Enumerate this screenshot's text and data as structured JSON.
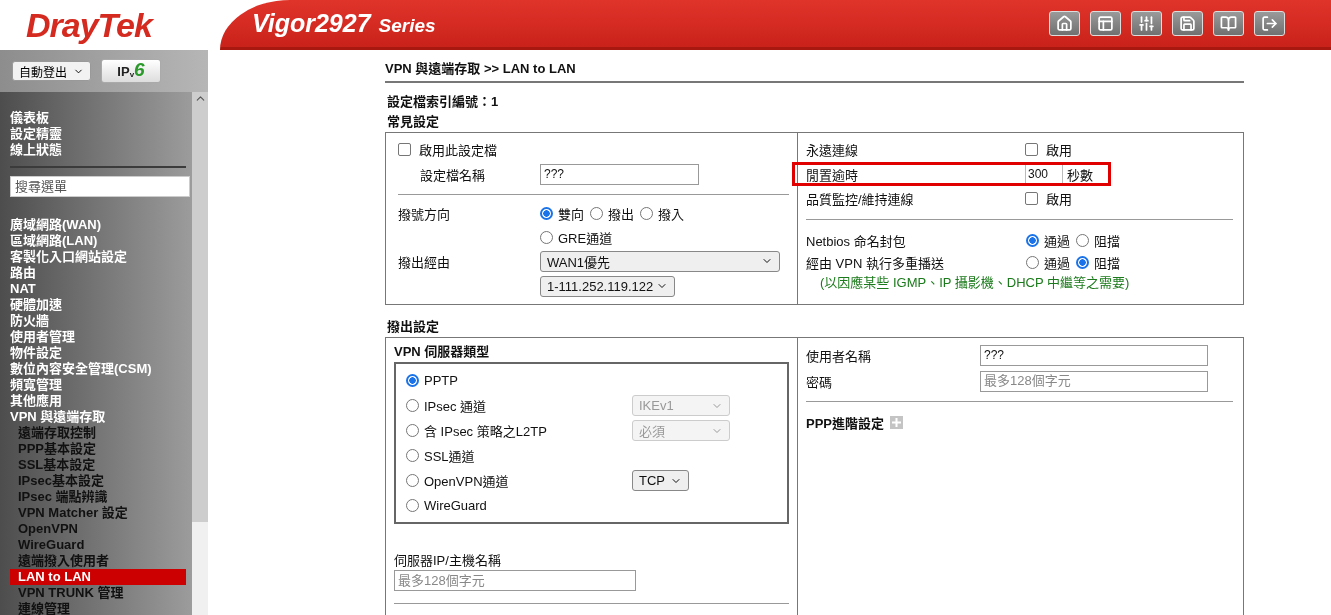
{
  "header": {
    "brand": "DrayTek",
    "model": "Vigor2927",
    "series": "Series"
  },
  "sidebar": {
    "logout_select": {
      "value": "自動登出"
    },
    "ipv6_button": {
      "ip": "IP",
      "v": "v",
      "six": "6"
    },
    "quick_links": [
      {
        "label": "儀表板",
        "selected": false
      },
      {
        "label": "設定精靈",
        "selected": false
      },
      {
        "label": "線上狀態",
        "selected": false
      }
    ],
    "search": {
      "placeholder": "搜尋選單"
    },
    "menu": [
      {
        "label": "廣域網路(WAN)",
        "selected": false
      },
      {
        "label": "區域網路(LAN)",
        "selected": false
      },
      {
        "label": "客製化入口網站設定",
        "selected": false
      },
      {
        "label": "路由",
        "selected": false
      },
      {
        "label": "NAT",
        "selected": false
      },
      {
        "label": "硬體加速",
        "selected": false
      },
      {
        "label": "防火牆",
        "selected": false
      },
      {
        "label": "使用者管理",
        "selected": false
      },
      {
        "label": "物件設定",
        "selected": false
      },
      {
        "label": "數位內容安全管理(CSM)",
        "selected": false
      },
      {
        "label": "頻寬管理",
        "selected": false
      },
      {
        "label": "其他應用",
        "selected": false
      },
      {
        "label": "VPN 與遠端存取",
        "selected": false,
        "children": [
          {
            "label": "遠端存取控制",
            "selected": false
          },
          {
            "label": "PPP基本設定",
            "selected": false
          },
          {
            "label": "SSL基本設定",
            "selected": false
          },
          {
            "label": "IPsec基本設定",
            "selected": false
          },
          {
            "label": "IPsec 端點辨識",
            "selected": false
          },
          {
            "label": "VPN Matcher 設定",
            "selected": false
          },
          {
            "label": "OpenVPN",
            "selected": false
          },
          {
            "label": "WireGuard",
            "selected": false
          },
          {
            "label": "遠端撥入使用者",
            "selected": false
          },
          {
            "label": "LAN to LAN",
            "selected": true
          },
          {
            "label": "VPN TRUNK 管理",
            "selected": false
          },
          {
            "label": "連線管理",
            "selected": false
          }
        ]
      }
    ]
  },
  "page": {
    "breadcrumb": "VPN 與遠端存取 >> LAN to LAN",
    "profile_index": "設定檔索引編號：1",
    "common": {
      "title": "常見設定",
      "enable_profile": {
        "label": "啟用此設定檔",
        "checked": false
      },
      "profile_name": {
        "label": "設定檔名稱",
        "value": "???"
      },
      "dial_direction": {
        "label": "撥號方向",
        "options": [
          {
            "label": "雙向",
            "selected": true
          },
          {
            "label": "撥出",
            "selected": false
          },
          {
            "label": "撥入",
            "selected": false
          },
          {
            "label": "GRE通道",
            "selected": false
          }
        ]
      },
      "dial_out_via": {
        "label": "撥出經由",
        "wan_select": "WAN1優先",
        "ip_select": "1-111.252.119.122"
      },
      "right_rows": [
        {
          "kind": "checkbox",
          "label": "永遠連線",
          "option": "啟用",
          "checked": false
        },
        {
          "kind": "input",
          "label": "閒置逾時",
          "value": "300",
          "unit": "秒數",
          "highlighted": true
        },
        {
          "kind": "checkbox",
          "label": "品質監控/維持連線",
          "option": "啟用",
          "checked": false
        }
      ],
      "packet_rows": [
        {
          "label": "Netbios 命名封包",
          "options": [
            {
              "label": "通過",
              "selected": true
            },
            {
              "label": "阻擋",
              "selected": false
            }
          ]
        },
        {
          "label": "經由 VPN 執行多重播送",
          "options": [
            {
              "label": "通過",
              "selected": false
            },
            {
              "label": "阻擋",
              "selected": true
            }
          ]
        }
      ],
      "note": "(以因應某些 IGMP、IP 攝影機、DHCP 中繼等之需要)"
    },
    "dial_out": {
      "title": "撥出設定",
      "server_type_title": "VPN 伺服器類型",
      "server_types": [
        {
          "label": "PPTP",
          "selected": true
        },
        {
          "label": "IPsec 通道",
          "selected": false,
          "select": {
            "value": "IKEv1",
            "disabled": true
          }
        },
        {
          "label": "含 IPsec 策略之L2TP",
          "selected": false,
          "select": {
            "value": "必須",
            "disabled": true
          }
        },
        {
          "label": "SSL通道",
          "selected": false
        },
        {
          "label": "OpenVPN通道",
          "selected": false,
          "select": {
            "value": "TCP",
            "disabled": false
          }
        },
        {
          "label": "WireGuard",
          "selected": false
        }
      ],
      "server_host": {
        "label": "伺服器IP/主機名稱",
        "placeholder": "最多128個字元"
      },
      "username": {
        "label": "使用者名稱",
        "value": "???"
      },
      "password": {
        "label": "密碼",
        "placeholder": "最多128個字元"
      },
      "ppp_advanced": {
        "label": "PPP進階設定",
        "expanded": false
      }
    }
  }
}
